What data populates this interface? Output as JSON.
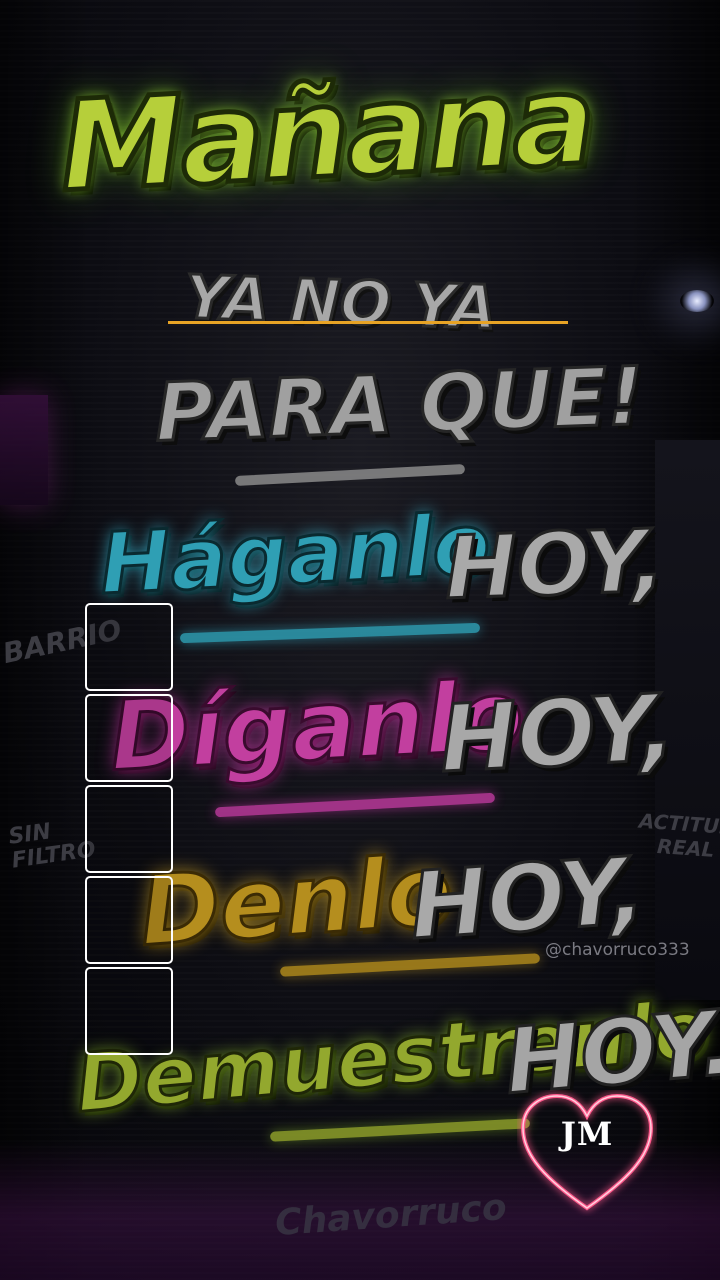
{
  "graffiti": {
    "line1": "Mañana",
    "line2": "YA NO YA",
    "line3": "PARA QUE!",
    "line4a": "Háganlo",
    "line4b": "HOY,",
    "line5a": "Díganlo",
    "line5b": "HOY,",
    "line6a": "Denlo",
    "line6b": "HOY,",
    "line7a": "Demuestrenlo",
    "line7b": "HOY."
  },
  "background_tags": {
    "barrio": "BARRIO",
    "sin_filtro": "SIN\nFILTRO",
    "actitud_real": "ACTITUD\nREAL",
    "bottom_signature": "Chavorruco"
  },
  "watermark": {
    "handle": "@chavorruco333"
  },
  "badge": {
    "monogram": "JM"
  },
  "selection_boxes": {
    "count": 5
  },
  "colors": {
    "green": "#b6cf3a",
    "cyan": "#2f9fb4",
    "magenta": "#c23f9f",
    "gold": "#b58e1e",
    "gray": "#a8a8a8",
    "strike_line": "#e7a325",
    "heart": "#ff5a8c"
  }
}
